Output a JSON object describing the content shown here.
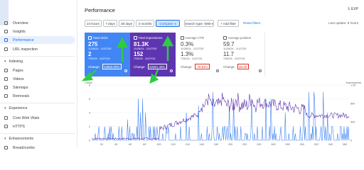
{
  "sidebar": {
    "items_top": [
      {
        "label": "Overview"
      },
      {
        "label": "Insights"
      },
      {
        "label": "Performance",
        "active": true
      },
      {
        "label": "URL inspection"
      }
    ],
    "sections": [
      {
        "label": "Indexing",
        "items": [
          "Pages",
          "Videos",
          "Sitemaps",
          "Removals"
        ]
      },
      {
        "label": "Experience",
        "items": [
          "Core Web Vitals",
          "HTTPS"
        ]
      },
      {
        "label": "Enhancements",
        "items": [
          "Breadcrumbs"
        ]
      }
    ]
  },
  "header": {
    "title": "Performance",
    "export_label": "EXP",
    "last_update": "Last update: 8 hours"
  },
  "filters": {
    "chips": [
      "24 hours",
      "7 days",
      "28 days",
      "3 months",
      "Compare"
    ],
    "selected": "Compare",
    "search_type": "Search type: Web",
    "add_filter": "+ Add filter",
    "reset_filters": "Reset filters"
  },
  "metrics": [
    {
      "title": "Total clicks",
      "value1": "275",
      "dates1": "11/28/24 - 11/27/25",
      "value2": "2",
      "dates2": "7/28/24 - 11/27/24",
      "change_label": "Change:",
      "change": "13650.00%",
      "theme": "blue"
    },
    {
      "title": "Total impressions",
      "value1": "81.3K",
      "dates1": "11/28/24 - 11/27/25",
      "value2": "152",
      "dates2": "7/28/24 - 11/27/24",
      "change_label": "Change:",
      "change": "53391.45%",
      "theme": "purple"
    },
    {
      "title": "Average CTR",
      "value1": "0.3%",
      "dates1": "11/28/24 - 11/27/25",
      "value2": "1.3%",
      "dates2": "7/28/24 - 11/27/24",
      "change_label": "Change:",
      "change": "-76.92%",
      "theme": "plain"
    },
    {
      "title": "Average position",
      "value1": "59.7",
      "dates1": "11/28/24 - 11/27/25",
      "value2": "11.7",
      "dates2": "7/28/24 - 11/27/24",
      "change_label": "Change:",
      "change": "48.00",
      "theme": "plain"
    }
  ],
  "chart_data": {
    "type": "line",
    "left_axis_label": "Clicks",
    "right_axis_label": "Impressions",
    "left_ticks": [
      "8",
      "6",
      "4",
      "2",
      "0"
    ],
    "right_ticks": [
      "1.2K",
      "800",
      "400",
      "0"
    ],
    "x_ticks": [
      "20",
      "40",
      "60",
      "80",
      "100",
      "120",
      "140",
      "160",
      "180",
      "200",
      "220",
      "240",
      "260",
      "280",
      "300",
      "320",
      "340",
      "360"
    ],
    "series": [
      {
        "name": "Clicks",
        "color": "#4285f4",
        "style": "spiky daily values, mostly 0-3 with spikes up to ~8"
      },
      {
        "name": "Impressions",
        "color": "#5e35b1",
        "style": "near zero first third, rising to ~800-1000 then declining to ~500"
      }
    ]
  },
  "colors": {
    "clicks": "#4285f4",
    "impressions": "#5e35b1",
    "annotation": "#2ecc40",
    "negative": "#d93025"
  }
}
